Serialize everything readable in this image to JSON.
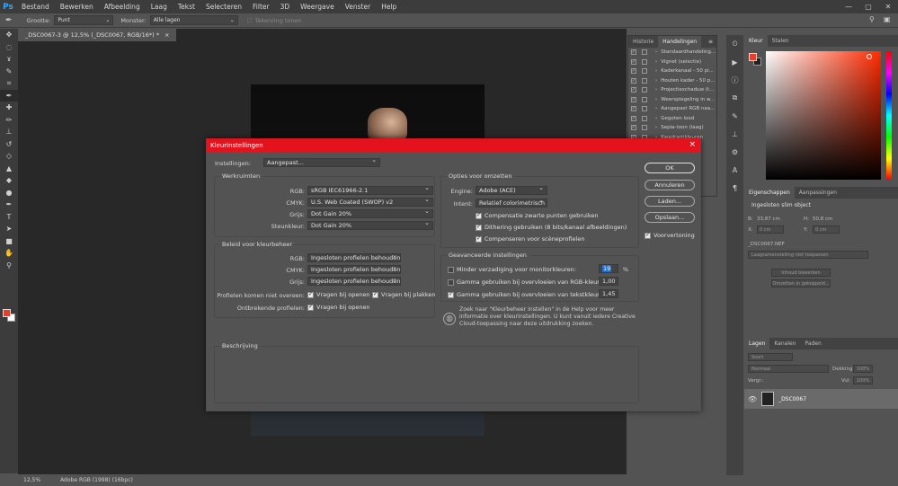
{
  "app": {
    "logo": "Ps",
    "menu": [
      "Bestand",
      "Bewerken",
      "Afbeelding",
      "Laag",
      "Tekst",
      "Selecteren",
      "Filter",
      "3D",
      "Weergave",
      "Venster",
      "Help"
    ],
    "window_controls": [
      "—",
      "▢",
      "✕"
    ]
  },
  "options_bar": {
    "size_label": "Grootte:",
    "size_value": "Punt",
    "sample_label": "Monster:",
    "sample_value": "Alle lagen",
    "ring_label": "Tekenring tonen"
  },
  "document": {
    "tab_title": "_DSC0067-3 @ 12,5% (_DSC0067, RGB/16*) *",
    "tab_close": "×",
    "status_zoom": "12,5%",
    "status_profile": "Adobe RGB (1998) (16bpc)"
  },
  "tools": [
    "move-icon",
    "marquee-icon",
    "lasso-icon",
    "quick-select-icon",
    "crop-icon",
    "eyedropper-icon",
    "healing-icon",
    "brush-icon",
    "stamp-icon",
    "history-brush-icon",
    "eraser-icon",
    "gradient-icon",
    "blur-icon",
    "dodge-icon",
    "pen-icon",
    "type-icon",
    "path-select-icon",
    "shape-icon",
    "hand-icon",
    "zoom-icon"
  ],
  "tool_glyphs": [
    "✥",
    "◌",
    "ɤ",
    "✎",
    "⌗",
    "✒",
    "✚",
    "✏",
    "⊥",
    "↺",
    "◇",
    "▲",
    "◆",
    "●",
    "✒",
    "T",
    "➤",
    "■",
    "✋",
    "⚲"
  ],
  "actions_panel": {
    "tabs": [
      "Historie",
      "Handelingen"
    ],
    "items": [
      {
        "name": "Standaardhandeling...",
        "checked": true
      },
      {
        "name": "Vignet (selectie)",
        "checked": true
      },
      {
        "name": "Kaderkanaal - 50 pi...",
        "checked": true
      },
      {
        "name": "Houten kader - 50 p...",
        "checked": true
      },
      {
        "name": "Projectieschaduw (t...",
        "checked": true
      },
      {
        "name": "Weerspiegeling in w...",
        "checked": true
      },
      {
        "name": "Aangepast RGB naa...",
        "checked": true
      },
      {
        "name": "Gegoten lood",
        "checked": true
      },
      {
        "name": "Sepia-toon (laag)",
        "checked": true
      },
      {
        "name": "Kwadrantkleuren",
        "checked": true
      }
    ]
  },
  "color_panel": {
    "tabs": [
      "Kleur",
      "Stalen"
    ],
    "fg": "#e53e2a",
    "bg": "#222222"
  },
  "properties_panel": {
    "tabs": [
      "Eigenschappen",
      "Aanpassingen"
    ],
    "title": "Ingesloten slim object",
    "w_label": "B:",
    "w_value": "33,87 cm",
    "h_label": "H:",
    "h_value": "50,8 cm",
    "x_label": "X:",
    "x_value": "0 cm",
    "y_label": "Y:",
    "y_value": "0 cm",
    "file": "_DSC0067.NEF",
    "comp_placeholder": "Laagsamenstelling niet toepassen",
    "edit_btn": "Inhoud bewerken",
    "convert_btn": "Omzetten in gekoppeld..."
  },
  "layers_panel": {
    "tabs": [
      "Lagen",
      "Kanalen",
      "Paden"
    ],
    "search": "Soort",
    "blend": "Normaal",
    "opacity_label": "Dekking:",
    "opacity": "100%",
    "lock_label": "Vergr.:",
    "fill_label": "Vul:",
    "fill": "100%",
    "layer_name": "_DSC0067"
  },
  "dialog": {
    "title": "Kleurinstellingen",
    "close": "×",
    "settings_label": "Instellingen:",
    "settings_value": "Aangepast...",
    "workspaces_title": "Werkruimten",
    "rgb_label": "RGB:",
    "rgb_value": "sRGB IEC61966-2.1",
    "cmyk_label": "CMYK:",
    "cmyk_value": "U.S. Web Coated (SWOP) v2",
    "gray_label": "Grijs:",
    "gray_value": "Dot Gain 20%",
    "spot_label": "Steunkleur:",
    "spot_value": "Dot Gain 20%",
    "policy_title": "Beleid voor kleurbeheer",
    "policy_rgb_label": "RGB:",
    "policy_rgb_value": "Ingesloten profielen behouden",
    "policy_cmyk_label": "CMYK:",
    "policy_cmyk_value": "Ingesloten profielen behouden",
    "policy_gray_label": "Grijs:",
    "policy_gray_value": "Ingesloten profielen behouden",
    "mismatch_label": "Profielen komen niet overeen:",
    "ask_open": "Vragen bij openen",
    "ask_paste": "Vragen bij plakken",
    "missing_label": "Ontbrekende profielen:",
    "ask_open2": "Vragen bij openen",
    "conversion_title": "Opties voor omzetten",
    "engine_label": "Engine:",
    "engine_value": "Adobe (ACE)",
    "intent_label": "Intent:",
    "intent_value": "Relatief colorimetrisch",
    "bpc": "Compensatie zwarte punten gebruiken",
    "dither": "Dithering gebruiken (8 bits/kanaal afbeeldingen)",
    "scene": "Compenseren voor scèneprofielen",
    "advanced_title": "Geavanceerde instellingen",
    "desat_label": "Minder verzadiging voor monitorkleuren:",
    "desat_value": "19",
    "desat_unit": "%",
    "blend_rgb_label": "Gamma gebruiken bij overvloeien van RGB-kleuren:",
    "blend_rgb_value": "1,00",
    "blend_text_label": "Gamma gebruiken bij overvloeien van tekstkleuren:",
    "blend_text_value": "1,45",
    "help_text": "Zoek naar \"Kleurbeheer instellen\" in de Help voor meer informatie over kleurinstellingen. U kunt vanuit iedere Creative Cloud-toepassing naar deze uitdrukking zoeken.",
    "description_title": "Beschrijving",
    "ok": "OK",
    "cancel": "Annuleren",
    "load": "Laden...",
    "save": "Opslaan...",
    "preview": "Voorvertoning"
  }
}
